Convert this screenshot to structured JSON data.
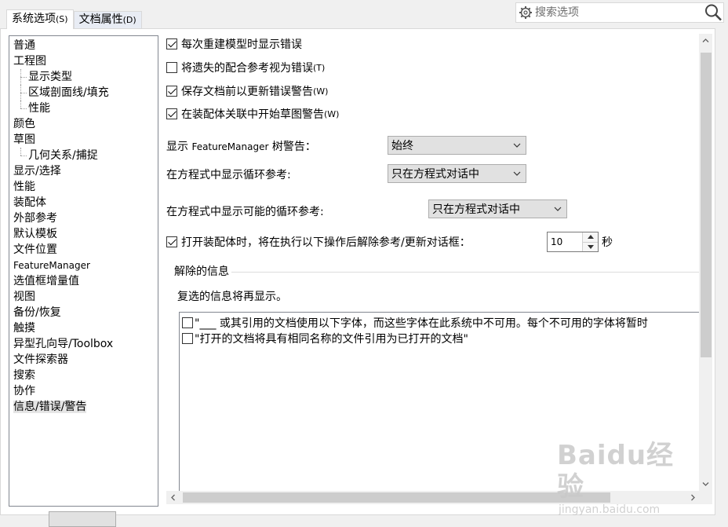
{
  "tabs": [
    {
      "label": "系统选项",
      "hotkey": "(S)"
    },
    {
      "label": "文档属性",
      "hotkey": "(D)"
    }
  ],
  "search": {
    "placeholder": "搜索选项"
  },
  "tree": {
    "items": [
      {
        "label": "普通"
      },
      {
        "label": "工程图"
      },
      {
        "label": "显示类型"
      },
      {
        "label": "区域剖面线/填充"
      },
      {
        "label": "性能"
      },
      {
        "label": "颜色"
      },
      {
        "label": "草图"
      },
      {
        "label": "几何关系/捕捉"
      },
      {
        "label": "显示/选择"
      },
      {
        "label": "性能"
      },
      {
        "label": "装配体"
      },
      {
        "label": "外部参考"
      },
      {
        "label": "默认模板"
      },
      {
        "label": "文件位置"
      },
      {
        "label": "FeatureManager"
      },
      {
        "label": "选值框增量值"
      },
      {
        "label": "视图"
      },
      {
        "label": "备份/恢复"
      },
      {
        "label": "触摸"
      },
      {
        "label": "异型孔向导/Toolbox"
      },
      {
        "label": "文件探索器"
      },
      {
        "label": "搜索"
      },
      {
        "label": "协作"
      },
      {
        "label": "信息/错误/警告"
      }
    ]
  },
  "options": {
    "cb1": {
      "label": "每次重建模型时显示错误",
      "checked": true
    },
    "cb2": {
      "label": "将遗失的配合参考视为错误",
      "hotkey": "(T)",
      "checked": false
    },
    "cb3": {
      "label": "保存文档前以更新错误警告",
      "hotkey": "(W)",
      "checked": true
    },
    "cb4": {
      "label": "在装配体关联中开始草图警告",
      "hotkey": "(W)",
      "checked": true
    },
    "featuremanager_warning": {
      "label_pre": "显示 ",
      "label_latin": "FeatureManager",
      "label_post": " 树警告：",
      "value": "始终"
    },
    "circular_ref": {
      "label": "在方程式中显示循环参考:",
      "value": "只在方程式对话中"
    },
    "possible_circular_ref": {
      "label": "在方程式中显示可能的循环参考:",
      "value": "只在方程式对话中"
    },
    "dismiss_refs": {
      "label": "打开装配体时，将在执行以下操作后解除参考/更新对话框：",
      "checked": true,
      "value": "10",
      "unit": "秒"
    }
  },
  "dismissed": {
    "title": "解除的信息",
    "hint": "复选的信息将再显示。",
    "items": [
      {
        "label": "\"___ 或其引用的文档使用以下字体，而这些字体在此系统中不可用。每个不可用的字体将暂时",
        "checked": false
      },
      {
        "label": "\"打开的文档将具有相同名称的文件引用为已打开的文档\"",
        "checked": false
      }
    ]
  },
  "watermark": {
    "logo": "Baidu经验",
    "url": "jingyan.baidu.com"
  }
}
